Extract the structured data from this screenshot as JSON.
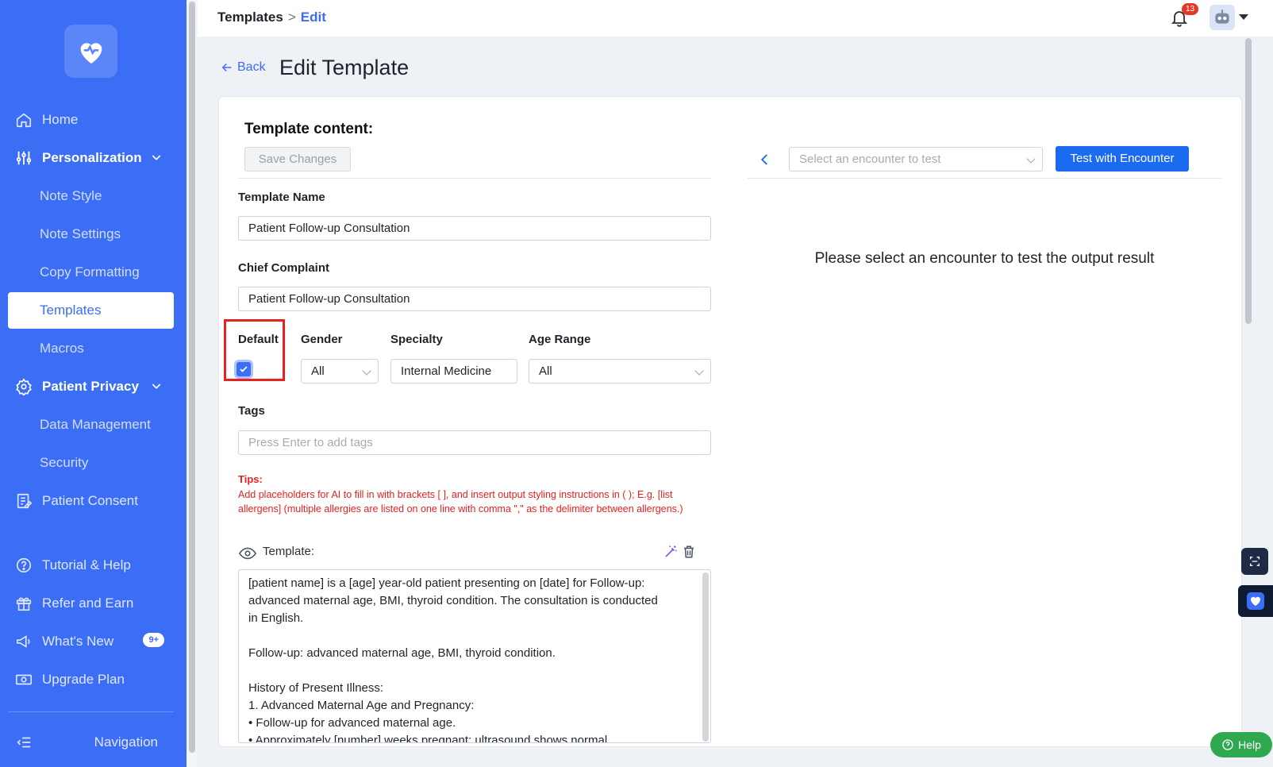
{
  "sidebar": {
    "items": [
      {
        "label": "Home"
      },
      {
        "label": "Personalization"
      },
      {
        "label": "Note Style"
      },
      {
        "label": "Note Settings"
      },
      {
        "label": "Copy Formatting"
      },
      {
        "label": "Templates"
      },
      {
        "label": "Macros"
      },
      {
        "label": "Patient Privacy"
      },
      {
        "label": "Data Management"
      },
      {
        "label": "Security"
      },
      {
        "label": "Patient Consent"
      },
      {
        "label": "Tutorial & Help"
      },
      {
        "label": "Refer and Earn"
      },
      {
        "label": "What's New",
        "badge": "9+"
      },
      {
        "label": "Upgrade Plan"
      },
      {
        "label": "Navigation"
      }
    ],
    "accent": "#3b6ef5"
  },
  "header": {
    "breadcrumb_root": "Templates",
    "breadcrumb_sep": ">",
    "breadcrumb_current": "Edit",
    "notification_count": "13"
  },
  "page": {
    "back_label": "Back",
    "title": "Edit Template"
  },
  "form": {
    "section_title": "Template content:",
    "save_label": "Save Changes",
    "template_name_label": "Template Name",
    "template_name_value": "Patient Follow-up Consultation",
    "chief_complaint_label": "Chief Complaint",
    "chief_complaint_value": "Patient Follow-up Consultation",
    "default_label": "Default",
    "default_checked": true,
    "gender_label": "Gender",
    "gender_value": "All",
    "specialty_label": "Specialty",
    "specialty_value": "Internal Medicine",
    "age_label": "Age Range",
    "age_value": "All",
    "tags_label": "Tags",
    "tags_placeholder": "Press Enter to add tags",
    "tips_title": "Tips:",
    "tips_body": "Add placeholders for AI to fill in with brackets [ ], and insert output styling instructions in ( ); E.g. [list allergens] (multiple allergies are listed on one line with comma \",\" as the delimiter between allergens.)",
    "template_label": "Template:",
    "template_lines": [
      "[patient name] is a [age] year-old patient presenting on [date] for Follow-up:",
      "advanced maternal age, BMI, thyroid condition. The consultation is conducted",
      "in English.",
      "",
      "Follow-up: advanced maternal age, BMI, thyroid condition.",
      "",
      "History of Present Illness:",
      "1. Advanced Maternal Age and Pregnancy:",
      "• Follow-up for advanced maternal age.",
      "• Approximately [number] weeks pregnant; ultrasound shows normal"
    ]
  },
  "test_panel": {
    "select_placeholder": "Select an encounter to test",
    "test_button_label": "Test with Encounter",
    "empty_message": "Please select an encounter to test the output result"
  },
  "help": {
    "label": "Help"
  }
}
